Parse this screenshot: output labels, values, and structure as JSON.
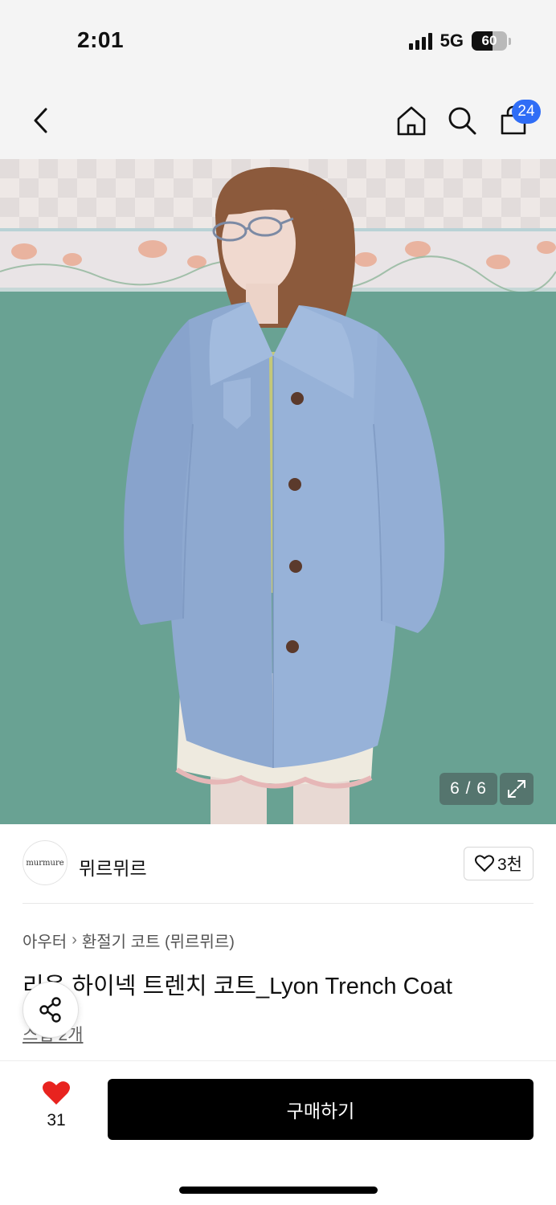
{
  "status_bar": {
    "time": "2:01",
    "network": "5G",
    "battery": "60",
    "battery_level": 0.6
  },
  "nav": {
    "cart_count": "24",
    "icons": [
      "back-icon",
      "home-icon",
      "search-icon",
      "cart-icon"
    ]
  },
  "gallery": {
    "counter": "6 / 6",
    "icons": [
      "expand-icon"
    ]
  },
  "brand": {
    "logo_text": "murmure",
    "name": "뮈르뮈르",
    "like_count": "3천"
  },
  "breadcrumb": {
    "items": [
      "아우터",
      "환절기 코트 (뮈르뮈르)"
    ],
    "separator": "›"
  },
  "product": {
    "title": "리옹 하이넥 트렌치 코트_Lyon Trench Coat",
    "review_link": "스냅 2개"
  },
  "bottom_bar": {
    "like_count": "31",
    "buy_label": "구매하기"
  },
  "colors": {
    "accent_blue": "#2f6df6",
    "heart_red": "#e8231f",
    "buy_button": "#000000"
  }
}
